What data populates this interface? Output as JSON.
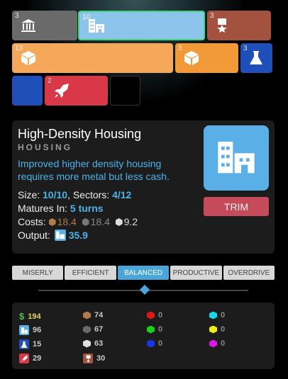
{
  "tiles": {
    "row1": [
      {
        "count": "3",
        "icon": "capitol-icon",
        "color": "#6a6a6a"
      },
      {
        "count": "10",
        "icon": "housing-icon",
        "color": "#8cc4ec",
        "selected": true
      },
      {
        "count": "3",
        "icon": "medal-icon",
        "color": "#a2523e"
      }
    ],
    "row2": [
      {
        "count": "13",
        "icon": "cube-icon",
        "color": "#f5a75a"
      },
      {
        "count": "3",
        "icon": "cube-icon",
        "color": "#f29a38"
      },
      {
        "count": "3",
        "icon": "flask-icon",
        "color": "#1f4fb8"
      }
    ],
    "row3": [
      {
        "count": "",
        "icon": "",
        "color": "#1f4fb8"
      },
      {
        "count": "2",
        "icon": "rocket-icon",
        "color": "#d83848"
      },
      {
        "count": "",
        "icon": "",
        "color": "#000"
      }
    ]
  },
  "building": {
    "name": "High-Density Housing",
    "category": "HOUSING",
    "description": "Improved higher density housing requires more metal but less cash.",
    "size_label": "Size:",
    "size_value": "10/10",
    "sectors_label": ", Sectors:",
    "sectors_value": "4/12",
    "matures_label": "Matures In:",
    "matures_value": "5 turns",
    "costs_label": "Costs:",
    "costs": [
      "18.4",
      "18.4",
      "9.2"
    ],
    "output_label": "Output:",
    "output_value": "35.9",
    "trim_label": "TRIM"
  },
  "modes": [
    "MISERLY",
    "EFFICIENT",
    "BALANCED",
    "PRODUCTIVE",
    "OVERDRIVE"
  ],
  "active_mode": "BALANCED",
  "resources": {
    "cash": "194",
    "housing": "96",
    "science": "15",
    "military": "29",
    "metal": "74",
    "dark_metal": "67",
    "white_metal": "63",
    "influence": "30",
    "red": "0",
    "green": "0",
    "blue": "0",
    "cyan": "0",
    "yellow": "0",
    "magenta": "0"
  },
  "colors": {
    "accent": "#4ab4ea",
    "trim": "#c54a5a"
  }
}
